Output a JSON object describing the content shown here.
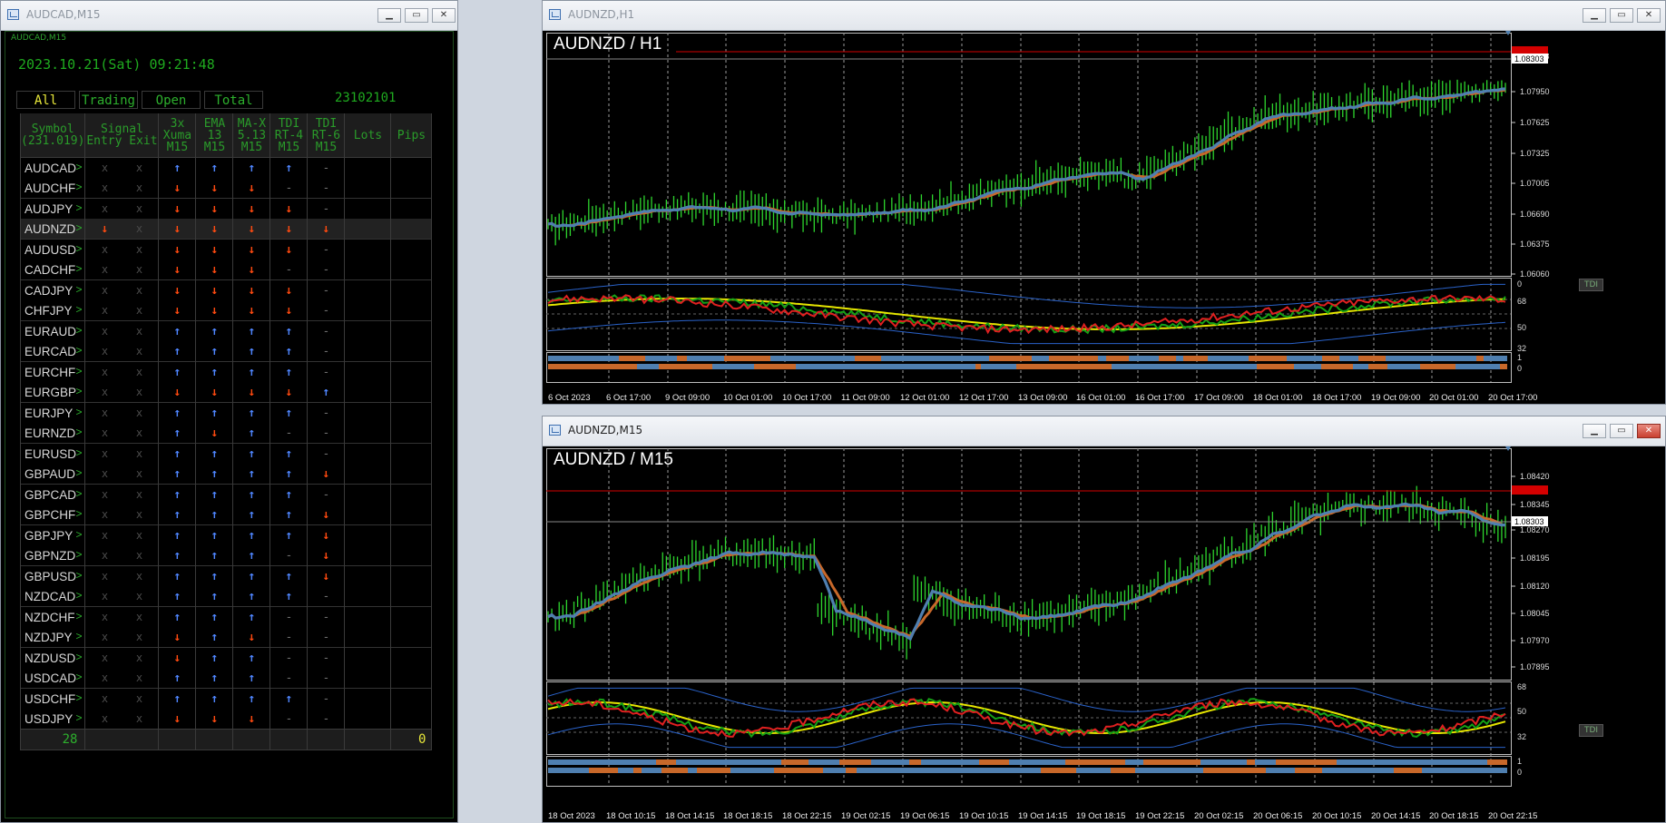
{
  "windows": {
    "left": {
      "title": "AUDCAD,M15"
    },
    "top_right": {
      "title": "AUDNZD,H1"
    },
    "bottom_right": {
      "title": "AUDNZD,M15"
    }
  },
  "dashboard": {
    "panel_title": "AUDCAD,M15",
    "datetime": "2023.10.21(Sat) 09:21:48",
    "filters": [
      "All",
      "Trading",
      "Open",
      "Total"
    ],
    "code": "23102101",
    "headers": {
      "symbol": [
        "Symbol",
        "(231.019)"
      ],
      "signal": [
        "Signal",
        "Entry",
        "Exit"
      ],
      "xuma": [
        "3x",
        "Xuma",
        "M15"
      ],
      "ema": [
        "EMA",
        "13",
        "M15"
      ],
      "max": [
        "MA-X",
        "5.13",
        "M15"
      ],
      "tdi4": [
        "TDI",
        "RT-4",
        "M15"
      ],
      "tdi6": [
        "TDI",
        "RT-6",
        "M15"
      ],
      "lots": "Lots",
      "pips": "Pips"
    },
    "rows": [
      {
        "sym": "AUDCAD",
        "entry": "x",
        "exit": "x",
        "c": [
          "up",
          "up",
          "up",
          "up",
          "-"
        ]
      },
      {
        "sym": "AUDCHF",
        "entry": "x",
        "exit": "x",
        "c": [
          "dn",
          "dn",
          "dn",
          "-",
          "-"
        ]
      },
      {
        "sym": "AUDJPY",
        "entry": "x",
        "exit": "x",
        "c": [
          "dn",
          "dn",
          "dn",
          "dn",
          "-"
        ]
      },
      {
        "sym": "AUDNZD",
        "entry": "dn",
        "exit": "x",
        "c": [
          "dn",
          "dn",
          "dn",
          "dn",
          "dn"
        ]
      },
      {
        "sym": "AUDUSD",
        "entry": "x",
        "exit": "x",
        "c": [
          "dn",
          "dn",
          "dn",
          "dn",
          "-"
        ]
      },
      {
        "sym": "CADCHF",
        "entry": "x",
        "exit": "x",
        "c": [
          "dn",
          "dn",
          "dn",
          "-",
          "-"
        ]
      },
      {
        "sym": "CADJPY",
        "entry": "x",
        "exit": "x",
        "c": [
          "dn",
          "dn",
          "dn",
          "dn",
          "-"
        ]
      },
      {
        "sym": "CHFJPY",
        "entry": "x",
        "exit": "x",
        "c": [
          "dn",
          "dn",
          "dn",
          "dn",
          "-"
        ]
      },
      {
        "sym": "EURAUD",
        "entry": "x",
        "exit": "x",
        "c": [
          "up",
          "up",
          "up",
          "up",
          "-"
        ]
      },
      {
        "sym": "EURCAD",
        "entry": "x",
        "exit": "x",
        "c": [
          "up",
          "up",
          "up",
          "up",
          "-"
        ]
      },
      {
        "sym": "EURCHF",
        "entry": "x",
        "exit": "x",
        "c": [
          "up",
          "up",
          "up",
          "up",
          "-"
        ]
      },
      {
        "sym": "EURGBP",
        "entry": "x",
        "exit": "x",
        "c": [
          "dn",
          "dn",
          "dn",
          "dn",
          "up"
        ]
      },
      {
        "sym": "EURJPY",
        "entry": "x",
        "exit": "x",
        "c": [
          "up",
          "up",
          "up",
          "up",
          "-"
        ]
      },
      {
        "sym": "EURNZD",
        "entry": "x",
        "exit": "x",
        "c": [
          "up",
          "dn",
          "up",
          "-",
          "-"
        ]
      },
      {
        "sym": "EURUSD",
        "entry": "x",
        "exit": "x",
        "c": [
          "up",
          "up",
          "up",
          "up",
          "-"
        ]
      },
      {
        "sym": "GBPAUD",
        "entry": "x",
        "exit": "x",
        "c": [
          "up",
          "up",
          "up",
          "up",
          "dn"
        ]
      },
      {
        "sym": "GBPCAD",
        "entry": "x",
        "exit": "x",
        "c": [
          "up",
          "up",
          "up",
          "up",
          "-"
        ]
      },
      {
        "sym": "GBPCHF",
        "entry": "x",
        "exit": "x",
        "c": [
          "up",
          "up",
          "up",
          "up",
          "dn"
        ]
      },
      {
        "sym": "GBPJPY",
        "entry": "x",
        "exit": "x",
        "c": [
          "up",
          "up",
          "up",
          "up",
          "dn"
        ]
      },
      {
        "sym": "GBPNZD",
        "entry": "x",
        "exit": "x",
        "c": [
          "up",
          "up",
          "up",
          "-",
          "dn"
        ]
      },
      {
        "sym": "GBPUSD",
        "entry": "x",
        "exit": "x",
        "c": [
          "up",
          "up",
          "up",
          "up",
          "dn"
        ]
      },
      {
        "sym": "NZDCAD",
        "entry": "x",
        "exit": "x",
        "c": [
          "up",
          "up",
          "up",
          "up",
          "-"
        ]
      },
      {
        "sym": "NZDCHF",
        "entry": "x",
        "exit": "x",
        "c": [
          "up",
          "up",
          "up",
          "-",
          "-"
        ]
      },
      {
        "sym": "NZDJPY",
        "entry": "x",
        "exit": "x",
        "c": [
          "dn",
          "up",
          "dn",
          "-",
          "-"
        ]
      },
      {
        "sym": "NZDUSD",
        "entry": "x",
        "exit": "x",
        "c": [
          "dn",
          "up",
          "up",
          "-",
          "-"
        ]
      },
      {
        "sym": "USDCAD",
        "entry": "x",
        "exit": "x",
        "c": [
          "up",
          "up",
          "up",
          "-",
          "-"
        ]
      },
      {
        "sym": "USDCHF",
        "entry": "x",
        "exit": "x",
        "c": [
          "up",
          "up",
          "up",
          "up",
          "-"
        ]
      },
      {
        "sym": "USDJPY",
        "entry": "x",
        "exit": "x",
        "c": [
          "dn",
          "dn",
          "dn",
          "-",
          "-"
        ]
      }
    ],
    "footer": {
      "count": "28",
      "pips": "0"
    }
  },
  "chart_h1": {
    "title": "AUDNZD / H1",
    "price_ticks": [
      "1.08303",
      "1.07950",
      "1.07625",
      "1.07325",
      "1.07005",
      "1.06690",
      "1.06375",
      "1.06060"
    ],
    "current_price": "1.08303",
    "tdi_label": "TDI",
    "tdi_ticks": [
      "0",
      "68",
      "50",
      "32"
    ],
    "bar_ticks": [
      "1",
      "0"
    ],
    "time_ticks": [
      "6 Oct 2023",
      "6 Oct 17:00",
      "9 Oct 09:00",
      "10 Oct 01:00",
      "10 Oct 17:00",
      "11 Oct 09:00",
      "12 Oct 01:00",
      "12 Oct 17:00",
      "13 Oct 09:00",
      "16 Oct 01:00",
      "16 Oct 17:00",
      "17 Oct 09:00",
      "18 Oct 01:00",
      "18 Oct 17:00",
      "19 Oct 09:00",
      "20 Oct 01:00",
      "20 Oct 17:00"
    ]
  },
  "chart_m15": {
    "title": "AUDNZD / M15",
    "price_ticks": [
      "1.08420",
      "1.08345",
      "1.08270",
      "1.08195",
      "1.08120",
      "1.08045",
      "1.07970",
      "1.07895"
    ],
    "current_price": "1.08303",
    "tdi_label": "TDI",
    "tdi_ticks": [
      "68",
      "50",
      "32"
    ],
    "bar_ticks": [
      "1",
      "0"
    ],
    "time_ticks": [
      "18 Oct 2023",
      "18 Oct 10:15",
      "18 Oct 14:15",
      "18 Oct 18:15",
      "18 Oct 22:15",
      "19 Oct 02:15",
      "19 Oct 06:15",
      "19 Oct 10:15",
      "19 Oct 14:15",
      "19 Oct 18:15",
      "19 Oct 22:15",
      "20 Oct 02:15",
      "20 Oct 06:15",
      "20 Oct 10:15",
      "20 Oct 14:15",
      "20 Oct 18:15",
      "20 Oct 22:15"
    ]
  },
  "colors": {
    "up": "#4f86ff",
    "down": "#ff4a10",
    "ma_blue": "#4f7fb0",
    "ma_orange": "#c8682a",
    "candle": "#2ed62e",
    "price_line": "#d40000"
  }
}
